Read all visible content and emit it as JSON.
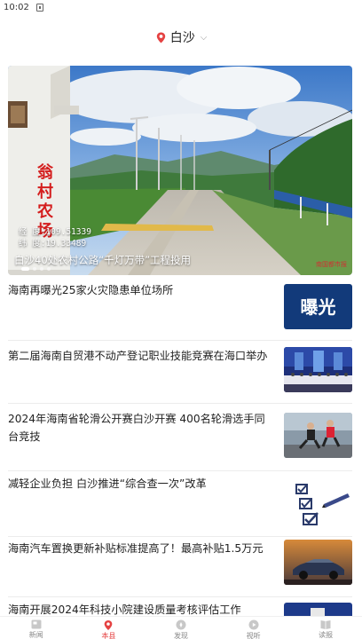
{
  "status_bar": {
    "time": "10:02"
  },
  "header": {
    "location": "白沙"
  },
  "banner": {
    "caption": "白沙40处农村公路“千灯万带”工程投用",
    "sign_text": "翁村农场",
    "coord_line1": "经    度:109.51339",
    "coord_line2": "纬    度:19.33489",
    "watermark": "南国都市报",
    "slides": 4,
    "active_slide": 1
  },
  "news": [
    {
      "title": "海南再曝光25家火灾隐患单位场所",
      "thumb_text": "曝光"
    },
    {
      "title": "第二届海南自贸港不动产登记职业技能竞赛在海口举办"
    },
    {
      "title": "2024年海南省轮滑公开赛白沙开赛 400名轮滑选手同台竞技"
    },
    {
      "title": "减轻企业负担 白沙推进“综合查一次”改革"
    },
    {
      "title": "海南汽车置换更新补贴标准提高了！最高补贴1.5万元"
    },
    {
      "title": "海南开展2024年科技小院建设质量考核评估工作"
    }
  ],
  "tabbar": {
    "items": [
      {
        "label": "新闻",
        "icon": "news-icon"
      },
      {
        "label": "本县",
        "icon": "location-pin-icon"
      },
      {
        "label": "发现",
        "icon": "compass-icon"
      },
      {
        "label": "视听",
        "icon": "play-icon"
      },
      {
        "label": "读报",
        "icon": "newspaper-icon"
      }
    ],
    "active_index": 1
  },
  "colors": {
    "accent": "#e54242"
  }
}
